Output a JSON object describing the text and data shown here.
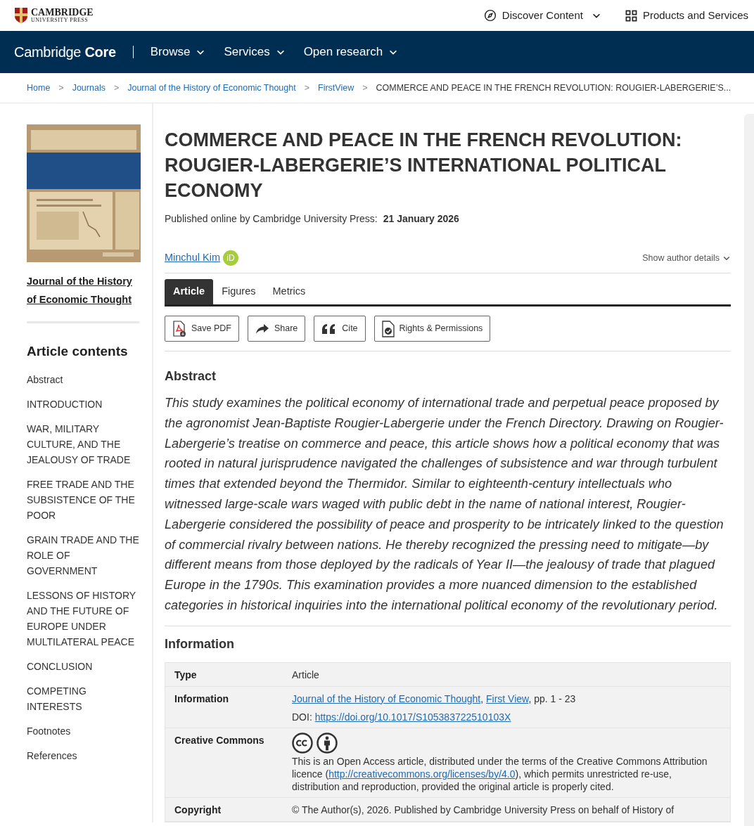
{
  "top_bar": {
    "publisher_line_1": "CAMBRIDGE",
    "publisher_line_2": "UNIVERSITY PRESS",
    "links": [
      {
        "label": "Discover Content",
        "kind": "compass"
      },
      {
        "label": "Products and Services",
        "kind": "grid"
      }
    ]
  },
  "nav": {
    "brand": "Cambridge **Core**",
    "items": [
      "Browse",
      "Services",
      "Open research"
    ]
  },
  "breadcrumbs": [
    {
      "label": "Home",
      "kind": "link"
    },
    {
      "separator": ">",
      "label": "Journals",
      "kind": "link"
    },
    {
      "separator": ">",
      "label": "Journal of the History of Economic Thought",
      "kind": "link"
    },
    {
      "separator": ">",
      "label": "FirstView",
      "kind": "link"
    },
    {
      "separator": ">",
      "label": "COMMERCE AND PEACE IN THE FRENCH REVOLUTION: ROUGIER-LABERGERIE’S...",
      "kind": "current"
    }
  ],
  "sidebar": {
    "journal_title": "Journal of the History of Economic Thought",
    "contents_heading": "Article contents",
    "items": [
      "Abstract",
      "INTRODUCTION",
      "WAR, MILITARY CULTURE, AND THE JEALOUSY OF TRADE",
      "FREE TRADE AND THE SUBSISTENCE OF THE POOR",
      "GRAIN TRADE AND THE ROLE OF GOVERNMENT",
      "LESSONS OF HISTORY AND THE FUTURE OF EUROPE UNDER MULTILATERAL PEACE",
      "CONCLUSION",
      "COMPETING INTERESTS",
      "Footnotes",
      "References"
    ]
  },
  "article": {
    "title": "COMMERCE AND PEACE IN THE FRENCH REVOLUTION: ROUGIER-LABERGERIE’S INTERNATIONAL POLITICAL ECONOMY",
    "published_label": "Published online by Cambridge University Press:",
    "published_date": "21 January 2026",
    "author": "Minchul Kim",
    "orcid": "iD",
    "author_details": "Show author details",
    "tabs": [
      {
        "label": "Article",
        "selected": true
      },
      {
        "label": "Figures",
        "selected": false
      },
      {
        "label": "Metrics",
        "selected": false
      }
    ],
    "actions": [
      {
        "label": "Save PDF",
        "kind": "pdf"
      },
      {
        "label": "Share",
        "kind": "share"
      },
      {
        "label": "Cite",
        "kind": "quote"
      },
      {
        "label": "Rights & Permissions",
        "kind": "rights"
      }
    ],
    "abstract_heading": "Abstract",
    "abstract": "This study examines the political economy of international trade and perpetual peace proposed by the agronomist Jean-Baptiste Rougier-Labergerie under the French Directory. Drawing on Rougier-Labergerie’s treatise on commerce and peace, this article shows how a political economy that was rooted in natural jurisprudence navigated the challenges of subsistence and war through turbulent times that extended beyond the Thermidor. Similar to eighteenth-century intellectuals who witnessed large-scale wars waged with public debt in the name of national interest, Rougier-Labergerie considered the possibility of peace and prosperity to be intricately linked to the question of commercial rivalry between nations. He thereby recognized the pressing need to mitigate—by different means from those deployed by the radicals of Year II—the jealousy of trade that plagued Europe in the 1790s. This examination provides a more nuanced dimension to the established categories in historical inquiries into the international political economy of the revolutionary period.",
    "information_heading": "Information",
    "info_rows": [
      {
        "label": "Type",
        "lines": [
          [
            {
              "kind": "text",
              "text": "Article"
            }
          ]
        ]
      },
      {
        "label": "Information",
        "lines": [
          [
            {
              "kind": "link",
              "text": "Journal of the History of Economic Thought"
            },
            {
              "kind": "text",
              "text": ","
            },
            {
              "kind": "link",
              "text": "First View"
            },
            {
              "kind": "text",
              "text": ", pp. 1 - 23"
            }
          ],
          [
            {
              "kind": "text",
              "text": "DOI:"
            },
            {
              "kind": "link",
              "text": "https://doi.org/10.1017/S105383722510103X"
            }
          ]
        ]
      },
      {
        "label": "Creative Commons",
        "badges": [
          {
            "kind": "cc"
          },
          {
            "kind": "by"
          }
        ],
        "lines": [
          [
            {
              "kind": "text",
              "text": "This is an Open Access article, distributed under the terms of the Creative Commons Attribution licence ("
            },
            {
              "kind": "link",
              "text": "http://creativecommons.org/licenses/by/4.0"
            },
            {
              "kind": "text",
              "text": "), which permits unrestricted re-use, distribution and reproduction, provided the original article is properly cited."
            }
          ]
        ]
      },
      {
        "label": "Copyright",
        "lines": [
          [
            {
              "kind": "text",
              "text": "© The Author(s), 2026. Published by Cambridge University Press on behalf of History of"
            }
          ]
        ]
      }
    ]
  }
}
